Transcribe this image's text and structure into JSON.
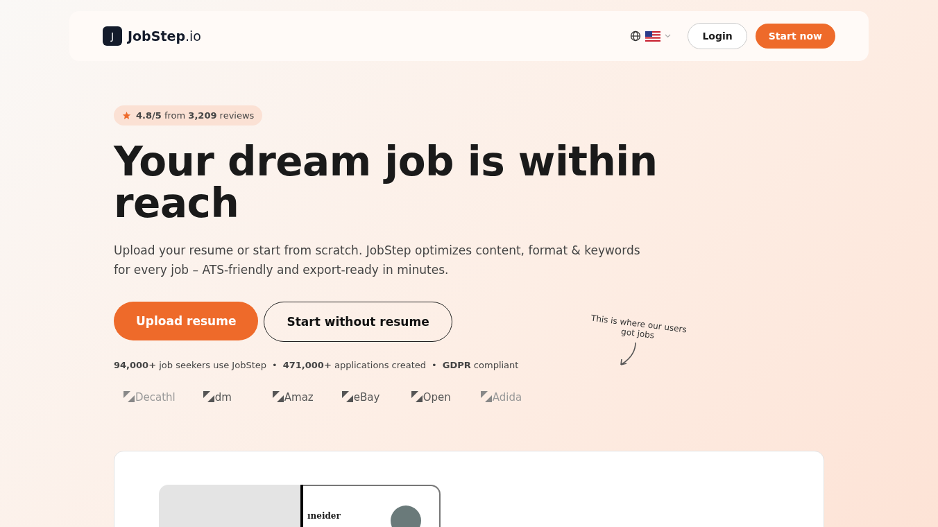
{
  "nav": {
    "logo_letter": "J",
    "brand": "JobStep",
    "brand_suffix": ".io",
    "login": "Login",
    "cta": "Start now"
  },
  "hero": {
    "rating": "**4.8/5** from **3,209** reviews",
    "title": "Your dream job is within reach",
    "subtitle": "Upload your resume or start from scratch. JobStep optimizes content, format & keywords for every job – ATS-friendly and export-ready in minutes.",
    "primary_button": "Upload resume",
    "secondary_button": "Start without resume",
    "stat_separator": "•",
    "stats": [
      "**94,000+** job seekers use JobStep",
      "**471,000+** applications created",
      "**GDPR** compliant"
    ],
    "note": "This is where our users got jobs",
    "logos": [
      "Decathl",
      "dm",
      "Amaz",
      "eBay",
      "Open",
      "Adida"
    ]
  },
  "preview": {
    "resume_name": "ıneider"
  }
}
